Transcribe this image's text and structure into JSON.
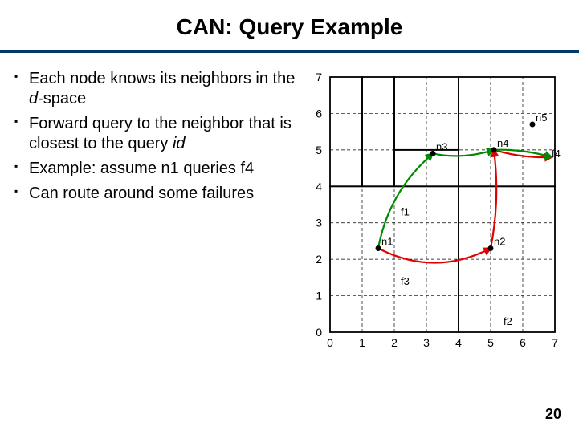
{
  "title": "CAN: Query Example",
  "bullets": [
    {
      "pre": "Each node knows its neighbors in the ",
      "em": "d",
      "post": "-space"
    },
    {
      "pre": "Forward query to the neighbor that is closest to the query ",
      "em": "id",
      "post": ""
    },
    {
      "pre": "Example: assume n1 queries f4",
      "em": "",
      "post": ""
    },
    {
      "pre": "Can route around some failures",
      "em": "",
      "post": ""
    }
  ],
  "page_number": "20",
  "chart_data": {
    "type": "scatter",
    "title": "",
    "xlabel": "",
    "ylabel": "",
    "xlim": [
      0,
      7
    ],
    "ylim": [
      0,
      7
    ],
    "x_ticks": [
      "0",
      "1",
      "2",
      "3",
      "4",
      "5",
      "6",
      "7"
    ],
    "y_ticks": [
      "0",
      "1",
      "2",
      "3",
      "4",
      "5",
      "6",
      "7"
    ],
    "zones": [
      {
        "x0": 0,
        "y0": 4,
        "x1": 1,
        "y1": 7
      },
      {
        "x0": 1,
        "y0": 4,
        "x1": 2,
        "y1": 7
      },
      {
        "x0": 2,
        "y0": 5,
        "x1": 4,
        "y1": 7
      },
      {
        "x0": 2,
        "y0": 4,
        "x1": 4,
        "y1": 5
      },
      {
        "x0": 4,
        "y0": 4,
        "x1": 7,
        "y1": 7
      },
      {
        "x0": 0,
        "y0": 0,
        "x1": 4,
        "y1": 4
      },
      {
        "x0": 4,
        "y0": 0,
        "x1": 7,
        "y1": 4
      }
    ],
    "nodes": [
      {
        "name": "n1",
        "x": 1.5,
        "y": 2.3
      },
      {
        "name": "n2",
        "x": 5.0,
        "y": 2.3
      },
      {
        "name": "n3",
        "x": 3.2,
        "y": 4.9
      },
      {
        "name": "n4",
        "x": 5.1,
        "y": 5.0
      },
      {
        "name": "n5",
        "x": 6.3,
        "y": 5.7
      }
    ],
    "files": [
      {
        "name": "f1",
        "x": 2.2,
        "y": 3.2
      },
      {
        "name": "f2",
        "x": 5.4,
        "y": 0.2
      },
      {
        "name": "f3",
        "x": 2.2,
        "y": 1.3
      },
      {
        "name": "f4",
        "x": 6.9,
        "y": 4.8
      }
    ],
    "route_segments": [
      {
        "from": "n1",
        "to": "n2",
        "color": "red",
        "curve": 0.9
      },
      {
        "from": "n2",
        "to": "n4",
        "color": "red",
        "curve": 0.25
      },
      {
        "from": "n4",
        "to": "f4",
        "color": "red",
        "curve": 0.15
      },
      {
        "from": "n1",
        "to": "n3",
        "color": "green",
        "curve": -0.6
      },
      {
        "from": "n3",
        "to": "n4",
        "color": "green",
        "curve": 0.25
      },
      {
        "from": "n4",
        "to": "f4",
        "color": "green",
        "curve": -0.15
      }
    ]
  }
}
